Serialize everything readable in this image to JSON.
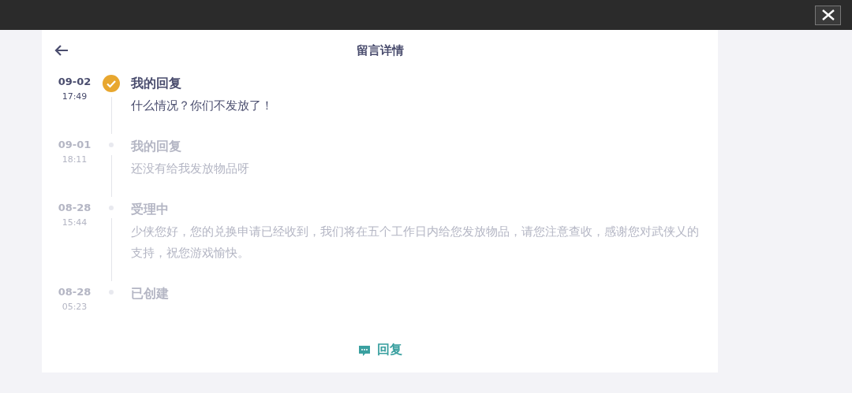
{
  "header": {
    "title": "留言详情"
  },
  "entries": [
    {
      "date": "09-02",
      "time": "17:49",
      "title": "我的回复",
      "text": "什么情况？你们不发放了！",
      "current": true
    },
    {
      "date": "09-01",
      "time": "18:11",
      "title": "我的回复",
      "text": "还没有给我发放物品呀",
      "current": false
    },
    {
      "date": "08-28",
      "time": "15:44",
      "title": "受理中",
      "text": "少侠您好，您的兑换申请已经收到，我们将在五个工作日内给您发放物品，请您注意查收，感谢您对武侠乂的支持，祝您游戏愉快。",
      "current": false
    },
    {
      "date": "08-28",
      "time": "05:23",
      "title": "已创建",
      "current": false
    }
  ],
  "reply_button": {
    "label": "回复"
  }
}
